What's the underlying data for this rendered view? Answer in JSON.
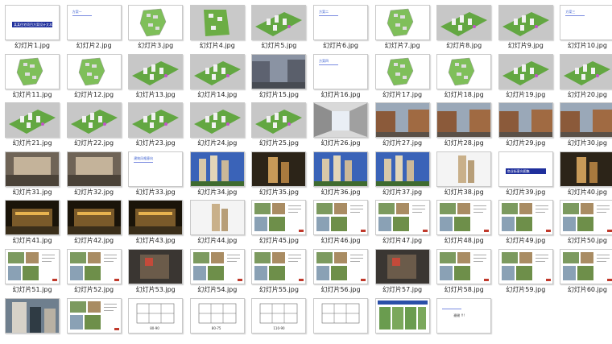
{
  "files": [
    {
      "name": "幻灯片1.jpg",
      "kind": "title-blue",
      "text": "某某住宅项目方案设计文本汇报"
    },
    {
      "name": "幻灯片2.jpg",
      "kind": "heading",
      "text": "方案一"
    },
    {
      "name": "幻灯片3.jpg",
      "kind": "plan-white"
    },
    {
      "name": "幻灯片4.jpg",
      "kind": "plan-grey"
    },
    {
      "name": "幻灯片5.jpg",
      "kind": "aerial-grey"
    },
    {
      "name": "幻灯片6.jpg",
      "kind": "heading",
      "text": "方案二"
    },
    {
      "name": "幻灯片7.jpg",
      "kind": "plan-white"
    },
    {
      "name": "幻灯片8.jpg",
      "kind": "aerial-grey"
    },
    {
      "name": "幻灯片9.jpg",
      "kind": "aerial-grey"
    },
    {
      "name": "幻灯片10.jpg",
      "kind": "heading",
      "text": "方案三"
    },
    {
      "name": "幻灯片11.jpg",
      "kind": "plan-white"
    },
    {
      "name": "幻灯片12.jpg",
      "kind": "plan-white"
    },
    {
      "name": "幻灯片13.jpg",
      "kind": "aerial-grey"
    },
    {
      "name": "幻灯片14.jpg",
      "kind": "aerial-grey"
    },
    {
      "name": "幻灯片15.jpg",
      "kind": "photo-street"
    },
    {
      "name": "幻灯片16.jpg",
      "kind": "heading",
      "text": "方案四"
    },
    {
      "name": "幻灯片17.jpg",
      "kind": "plan-white"
    },
    {
      "name": "幻灯片18.jpg",
      "kind": "plan-white"
    },
    {
      "name": "幻灯片19.jpg",
      "kind": "aerial-grey"
    },
    {
      "name": "幻灯片20.jpg",
      "kind": "aerial-grey"
    },
    {
      "name": "幻灯片21.jpg",
      "kind": "aerial-grey"
    },
    {
      "name": "幻灯片22.jpg",
      "kind": "aerial-grey"
    },
    {
      "name": "幻灯片23.jpg",
      "kind": "aerial-grey"
    },
    {
      "name": "幻灯片24.jpg",
      "kind": "aerial-grey"
    },
    {
      "name": "幻灯片25.jpg",
      "kind": "aerial-grey"
    },
    {
      "name": "幻灯片26.jpg",
      "kind": "street-grey"
    },
    {
      "name": "幻灯片27.jpg",
      "kind": "street-brown"
    },
    {
      "name": "幻灯片28.jpg",
      "kind": "street-brown"
    },
    {
      "name": "幻灯片29.jpg",
      "kind": "street-brown"
    },
    {
      "name": "幻灯片30.jpg",
      "kind": "street-brown"
    },
    {
      "name": "幻灯片31.jpg",
      "kind": "photo-mall"
    },
    {
      "name": "幻灯片32.jpg",
      "kind": "photo-mall"
    },
    {
      "name": "幻灯片33.jpg",
      "kind": "heading",
      "text": "建筑风格意向"
    },
    {
      "name": "幻灯片34.jpg",
      "kind": "tower-sky"
    },
    {
      "name": "幻灯片35.jpg",
      "kind": "tower-dark"
    },
    {
      "name": "幻灯片36.jpg",
      "kind": "tower-sky"
    },
    {
      "name": "幻灯片37.jpg",
      "kind": "tower-sky"
    },
    {
      "name": "幻灯片38.jpg",
      "kind": "tower-white"
    },
    {
      "name": "幻灯片39.jpg",
      "kind": "title-blue",
      "text": "商业街意向图集"
    },
    {
      "name": "幻灯片40.jpg",
      "kind": "tower-dark"
    },
    {
      "name": "幻灯片41.jpg",
      "kind": "night-black"
    },
    {
      "name": "幻灯片42.jpg",
      "kind": "night-black"
    },
    {
      "name": "幻灯片43.jpg",
      "kind": "night-black"
    },
    {
      "name": "幻灯片44.jpg",
      "kind": "tower-white"
    },
    {
      "name": "幻灯片45.jpg",
      "kind": "collage"
    },
    {
      "name": "幻灯片46.jpg",
      "kind": "collage"
    },
    {
      "name": "幻灯片47.jpg",
      "kind": "collage"
    },
    {
      "name": "幻灯片48.jpg",
      "kind": "collage"
    },
    {
      "name": "幻灯片49.jpg",
      "kind": "collage"
    },
    {
      "name": "幻灯片50.jpg",
      "kind": "collage"
    },
    {
      "name": "幻灯片51.jpg",
      "kind": "collage"
    },
    {
      "name": "幻灯片52.jpg",
      "kind": "collage"
    },
    {
      "name": "幻灯片53.jpg",
      "kind": "photo-dark"
    },
    {
      "name": "幻灯片54.jpg",
      "kind": "collage"
    },
    {
      "name": "幻灯片55.jpg",
      "kind": "collage"
    },
    {
      "name": "幻灯片56.jpg",
      "kind": "collage"
    },
    {
      "name": "幻灯片57.jpg",
      "kind": "photo-dark"
    },
    {
      "name": "幻灯片58.jpg",
      "kind": "collage"
    },
    {
      "name": "幻灯片59.jpg",
      "kind": "collage"
    },
    {
      "name": "幻灯片60.jpg",
      "kind": "collage"
    },
    {
      "name": "",
      "kind": "tower-photo"
    },
    {
      "name": "",
      "kind": "collage"
    },
    {
      "name": "",
      "kind": "floorplan",
      "caption": "80-90"
    },
    {
      "name": "",
      "kind": "floorplan",
      "caption": "80-75"
    },
    {
      "name": "",
      "kind": "floorplan",
      "caption": "110-90"
    },
    {
      "name": "",
      "kind": "floorplan"
    },
    {
      "name": "",
      "kind": "table-blue"
    },
    {
      "name": "",
      "kind": "heading",
      "text": "谢谢 !!!"
    }
  ],
  "colors": {
    "accent_blue": "#1f2f9c",
    "plan_green": "#58a83a",
    "aerial_bg": "#c7c7c7",
    "night": "#1a1409"
  }
}
